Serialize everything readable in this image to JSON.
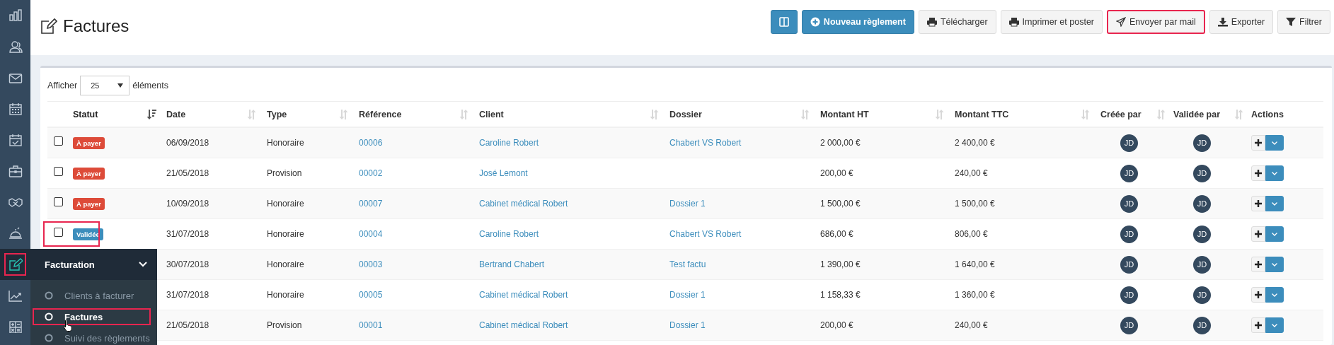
{
  "sidebar": {
    "items": [
      {
        "kind": "bars",
        "selected": false,
        "highlighted": false
      },
      {
        "kind": "users",
        "selected": false,
        "highlighted": false
      },
      {
        "kind": "mail",
        "selected": false,
        "highlighted": false
      },
      {
        "kind": "calendar",
        "selected": false,
        "highlighted": false
      },
      {
        "kind": "calendar-check",
        "selected": false,
        "highlighted": false
      },
      {
        "kind": "briefcase",
        "selected": false,
        "highlighted": false
      },
      {
        "kind": "handshake",
        "selected": false,
        "highlighted": false
      },
      {
        "kind": "bell",
        "selected": false,
        "highlighted": false
      },
      {
        "kind": "edit",
        "selected": true,
        "highlighted": true
      },
      {
        "kind": "chart",
        "selected": false,
        "highlighted": false
      },
      {
        "kind": "calculator",
        "selected": false,
        "highlighted": false
      }
    ]
  },
  "flyout": {
    "title": "Facturation",
    "items": [
      {
        "label": "Clients à facturer",
        "selected": false,
        "highlighted": false
      },
      {
        "label": "Factures",
        "selected": true,
        "highlighted": true
      },
      {
        "label": "Suivi des règlements",
        "selected": false,
        "highlighted": false
      }
    ]
  },
  "page": {
    "title": "Factures"
  },
  "toolbar": [
    {
      "kind": "primary",
      "highlighted": false
    },
    {
      "label": "Nouveau règlement",
      "kind": "primary",
      "highlighted": false
    },
    {
      "label": "Télécharger",
      "kind": "default",
      "highlighted": false
    },
    {
      "label": "Imprimer et poster",
      "kind": "default",
      "highlighted": false
    },
    {
      "label": "Envoyer par mail",
      "kind": "default",
      "highlighted": true
    },
    {
      "label": "Exporter",
      "kind": "default",
      "highlighted": false
    },
    {
      "label": "Filtrer",
      "kind": "default",
      "highlighted": false
    }
  ],
  "length_control": {
    "prefix": "Afficher",
    "value": "25",
    "suffix": "éléments"
  },
  "table": {
    "columns": [
      {
        "label": "Statut",
        "sortable": true,
        "sorted": true
      },
      {
        "label": "Date",
        "sortable": true,
        "sorted": false
      },
      {
        "label": "Type",
        "sortable": true,
        "sorted": false
      },
      {
        "label": "Référence",
        "sortable": true,
        "sorted": false
      },
      {
        "label": "Client",
        "sortable": true,
        "sorted": false
      },
      {
        "label": "Dossier",
        "sortable": true,
        "sorted": false
      },
      {
        "label": "Montant HT",
        "sortable": true,
        "sorted": false
      },
      {
        "label": "Montant TTC",
        "sortable": true,
        "sorted": false
      },
      {
        "label": "Créée par",
        "sortable": true,
        "sorted": false
      },
      {
        "label": "Validée par",
        "sortable": true,
        "sorted": false
      },
      {
        "label": "Actions",
        "sortable": false,
        "sorted": false
      }
    ],
    "rows": [
      {
        "checked": false,
        "highlighted": false,
        "status": {
          "label": "À payer",
          "kind": "due"
        },
        "date": "06/09/2018",
        "type": "Honoraire",
        "reference": "00006",
        "client": "Caroline Robert",
        "dossier": "Chabert VS Robert",
        "amount_ht": "2 000,00 €",
        "amount_ttc": "2 400,00 €",
        "created_by": "JD",
        "validated_by": "JD"
      },
      {
        "checked": false,
        "highlighted": false,
        "status": {
          "label": "À payer",
          "kind": "due"
        },
        "date": "21/05/2018",
        "type": "Provision",
        "reference": "00002",
        "client": "José Lemont",
        "amount_ht": "200,00 €",
        "amount_ttc": "240,00 €",
        "created_by": "JD",
        "validated_by": "JD"
      },
      {
        "checked": false,
        "highlighted": false,
        "status": {
          "label": "À payer",
          "kind": "due"
        },
        "date": "10/09/2018",
        "type": "Honoraire",
        "reference": "00007",
        "client": "Cabinet médical Robert",
        "dossier": "Dossier 1",
        "amount_ht": "1 500,00 €",
        "amount_ttc": "1 500,00 €",
        "created_by": "JD",
        "validated_by": "JD"
      },
      {
        "checked": false,
        "highlighted": true,
        "status": {
          "label": "Validée",
          "kind": "validated"
        },
        "date": "31/07/2018",
        "type": "Honoraire",
        "reference": "00004",
        "client": "Caroline Robert",
        "dossier": "Chabert VS Robert",
        "amount_ht": "686,00 €",
        "amount_ttc": "806,00 €",
        "created_by": "JD",
        "validated_by": "JD"
      },
      {
        "highlighted": false,
        "date": "30/07/2018",
        "type": "Honoraire",
        "reference": "00003",
        "client": "Bertrand Chabert",
        "dossier": "Test factu",
        "amount_ht": "1 390,00 €",
        "amount_ttc": "1 640,00 €",
        "created_by": "JD",
        "validated_by": "JD"
      },
      {
        "highlighted": false,
        "date": "31/07/2018",
        "type": "Honoraire",
        "reference": "00005",
        "client": "Cabinet médical Robert",
        "dossier": "Dossier 1",
        "amount_ht": "1 158,33 €",
        "amount_ttc": "1 360,00 €",
        "created_by": "JD",
        "validated_by": "JD"
      },
      {
        "highlighted": false,
        "date": "21/05/2018",
        "type": "Provision",
        "reference": "00001",
        "client": "Cabinet médical Robert",
        "dossier": "Dossier 1",
        "amount_ht": "200,00 €",
        "amount_ttc": "240,00 €",
        "created_by": "JD",
        "validated_by": "JD"
      }
    ]
  }
}
